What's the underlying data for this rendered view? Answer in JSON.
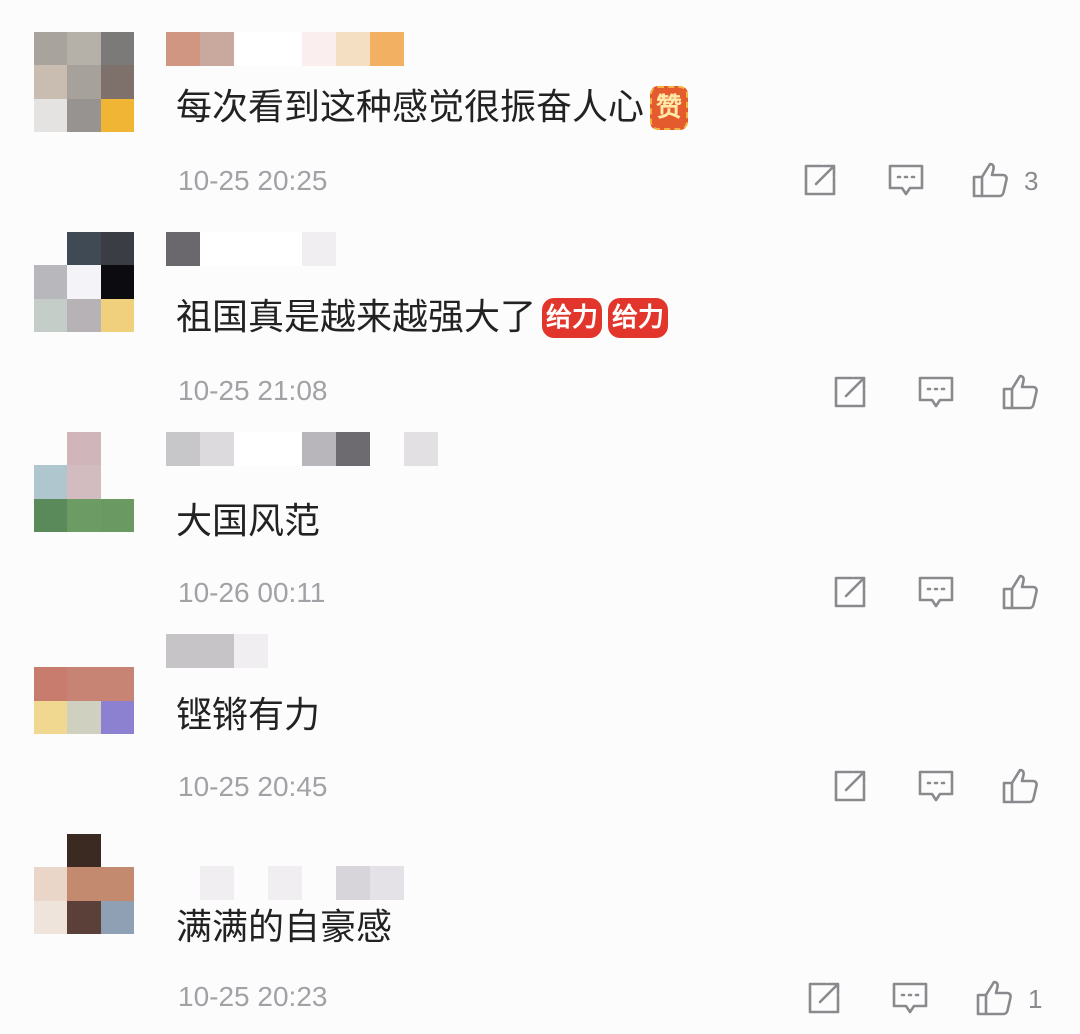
{
  "comments": [
    {
      "text": "每次看到这种感觉很振奋人心",
      "emoji": "赞",
      "emoji_style": "zan",
      "time": "10-25 20:25",
      "likes": "3",
      "avatar_colors": [
        "#a9a39e",
        "#b5b0a8",
        "#7c7a78",
        "#c9bcb0",
        "#a7a19b",
        "#7e706a",
        "#e5e3e2",
        "#979391",
        "#f0b534"
      ],
      "name_colors": [
        "#d19682",
        "#c9a89e",
        "#ffffff",
        "#ffffff",
        "#fbeeee",
        "#f5dfc2",
        "#f2b062"
      ]
    },
    {
      "text": "祖国真是越来越强大了",
      "emoji": "给力",
      "emoji_style": "gj",
      "time": "10-25 21:08",
      "likes": "",
      "avatar_colors": [
        "#fdfcfd",
        "#3f4a55",
        "#3a3d43",
        "#b8b7bb",
        "#f4f3f7",
        "#0c0c10",
        "#c5cdc9",
        "#b6b2b6",
        "#f0d07c"
      ],
      "name_colors": [
        "#6a686c",
        "#ffffff",
        "#ffffff",
        "#ffffff",
        "#f0eef1"
      ]
    },
    {
      "text": "大国风范",
      "emoji": "",
      "emoji_style": "",
      "time": "10-26 00:11",
      "likes": "",
      "avatar_colors": [
        "#fdfcfd",
        "#d0b6ba",
        "#fdfcfd",
        "#b0c6cf",
        "#d3bcbf",
        "#fdfcfd",
        "#5a8a5a",
        "#6c9b63",
        "#6a9a62"
      ],
      "name_colors": [
        "#c7c6c9",
        "#dcdadd",
        "#ffffff",
        "#ffffff",
        "#b8b6ba",
        "#6d6b70",
        "#fdfcfd",
        "#e2e0e3"
      ]
    },
    {
      "text": "铿锵有力",
      "emoji": "",
      "emoji_style": "",
      "time": "10-25 20:45",
      "likes": "",
      "avatar_colors": [
        "#fdfcfd",
        "#fdfcfd",
        "#fdfcfd",
        "#c77c6e",
        "#c78474",
        "#c78474",
        "#f0d890",
        "#d0d0c0",
        "#8c80d0"
      ],
      "name_colors": [
        "#c6c4c7",
        "#c6c4c7",
        "#f0eef1"
      ]
    },
    {
      "text": "满满的自豪感",
      "emoji": "",
      "emoji_style": "",
      "time": "10-25 20:23",
      "likes": "1",
      "avatar_colors": [
        "#fdfcfd",
        "#3b2a22",
        "#fdfcfd",
        "#e9d6c8",
        "#c48a70",
        "#c48a70",
        "#efe4dc",
        "#5a4038",
        "#8fa0b5"
      ],
      "name_colors": [
        "#fdfcfd",
        "#f0eef1",
        "#fdfcfd",
        "#f0eef1",
        "#fdfcfd",
        "#d7d5d9",
        "#e4e2e6"
      ]
    }
  ],
  "icons": {
    "share": "share-icon",
    "reply": "comment-icon",
    "like": "thumbs-up-icon"
  },
  "colors": {
    "text": "#222222",
    "meta": "#a2a2a6",
    "icon": "#8a8a8e"
  }
}
